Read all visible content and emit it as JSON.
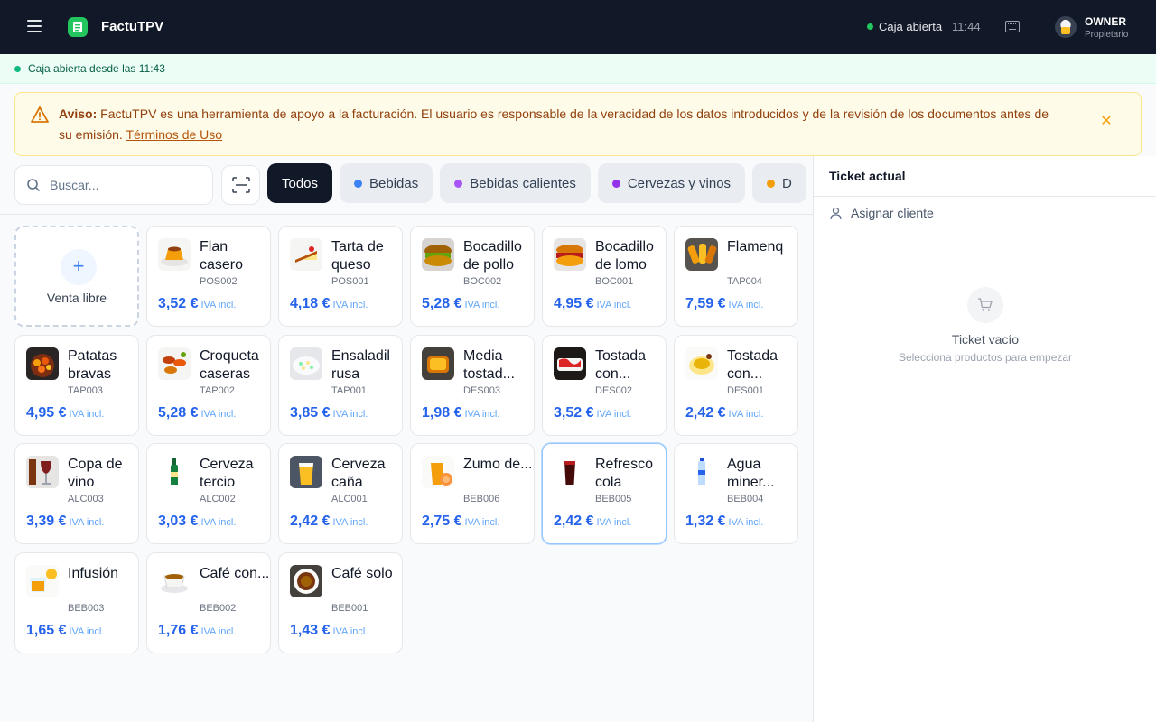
{
  "header": {
    "app_title": "FactuTPV",
    "status": "Caja abierta",
    "time": "11:44",
    "user_name": "OWNER",
    "user_role": "Propietario"
  },
  "status_strip": {
    "text": "Caja abierta desde las 11:43"
  },
  "warning": {
    "label": "Aviso:",
    "text": "FactuTPV es una herramienta de apoyo a la facturación. El usuario es responsable de la veracidad de los datos introducidos y de la revisión de los documentos antes de su emisión.",
    "link": "Términos de Uso"
  },
  "search": {
    "placeholder": "Buscar..."
  },
  "tabs": [
    {
      "label": "Todos",
      "active": true
    },
    {
      "label": "Bebidas",
      "color": "#3b82f6"
    },
    {
      "label": "Bebidas calientes",
      "color": "#a855f7"
    },
    {
      "label": "Cervezas y vinos",
      "color": "#9333ea"
    },
    {
      "label": "D",
      "color": "#f59e0b"
    }
  ],
  "free_sale": {
    "label": "Venta libre"
  },
  "iva_label": "IVA incl.",
  "products": [
    {
      "name": "Flan casero",
      "code": "POS002",
      "price": "3,52 €",
      "thumb": "flan"
    },
    {
      "name": "Tarta de queso",
      "code": "POS001",
      "price": "4,18 €",
      "thumb": "cake"
    },
    {
      "name": "Bocadillo de pollo",
      "code": "BOC002",
      "price": "5,28 €",
      "thumb": "sandwich"
    },
    {
      "name": "Bocadillo de lomo",
      "code": "BOC001",
      "price": "4,95 €",
      "thumb": "sandwich2"
    },
    {
      "name": "Flamenq",
      "code": "TAP004",
      "price": "7,59 €",
      "thumb": "fried"
    },
    {
      "name": "Patatas bravas",
      "code": "TAP003",
      "price": "4,95 €",
      "thumb": "bravas"
    },
    {
      "name": "Croqueta caseras",
      "code": "TAP002",
      "price": "5,28 €",
      "thumb": "croquetas"
    },
    {
      "name": "Ensaladil rusa",
      "code": "TAP001",
      "price": "3,85 €",
      "thumb": "salad"
    },
    {
      "name": "Media tostad...",
      "code": "DES003",
      "price": "1,98 €",
      "thumb": "toast"
    },
    {
      "name": "Tostada con...",
      "code": "DES002",
      "price": "3,52 €",
      "thumb": "toast2"
    },
    {
      "name": "Tostada con...",
      "code": "DES001",
      "price": "2,42 €",
      "thumb": "toast3"
    },
    {
      "name": "Copa de vino",
      "code": "ALC003",
      "price": "3,39 €",
      "thumb": "wine"
    },
    {
      "name": "Cerveza tercio",
      "code": "ALC002",
      "price": "3,03 €",
      "thumb": "bottle"
    },
    {
      "name": "Cerveza caña",
      "code": "ALC001",
      "price": "2,42 €",
      "thumb": "beer"
    },
    {
      "name": "Zumo de...",
      "code": "BEB006",
      "price": "2,75 €",
      "thumb": "juice"
    },
    {
      "name": "Refresco cola",
      "code": "BEB005",
      "price": "2,42 €",
      "thumb": "cola",
      "hover": true
    },
    {
      "name": "Agua miner...",
      "code": "BEB004",
      "price": "1,32 €",
      "thumb": "water"
    },
    {
      "name": "Infusión",
      "code": "BEB003",
      "price": "1,65 €",
      "thumb": "tea"
    },
    {
      "name": "Café con...",
      "code": "BEB002",
      "price": "1,76 €",
      "thumb": "coffee"
    },
    {
      "name": "Café solo",
      "code": "BEB001",
      "price": "1,43 €",
      "thumb": "espresso"
    }
  ],
  "ticket": {
    "title": "Ticket actual",
    "assign_client": "Asignar cliente",
    "empty_title": "Ticket vacío",
    "empty_subtitle": "Selecciona productos para empezar"
  }
}
